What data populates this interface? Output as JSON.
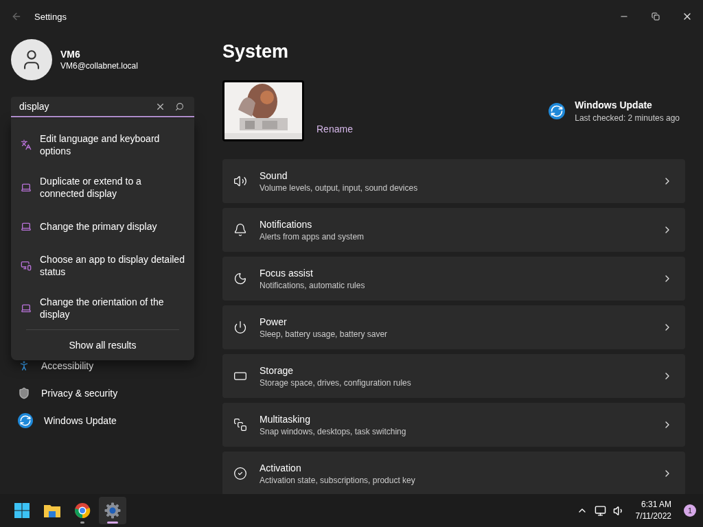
{
  "window": {
    "title": "Settings"
  },
  "profile": {
    "name": "VM6",
    "email": "VM6@collabnet.local"
  },
  "search": {
    "value": "display"
  },
  "search_results": {
    "items": [
      {
        "label": "Edit language and keyboard options"
      },
      {
        "label": "Duplicate or extend to a connected display"
      },
      {
        "label": "Change the primary display"
      },
      {
        "label": "Choose an app to display detailed status"
      },
      {
        "label": "Change the orientation of the display"
      }
    ],
    "show_all": "Show all results"
  },
  "sidebar": {
    "items": [
      {
        "label": "Accessibility"
      },
      {
        "label": "Privacy & security"
      },
      {
        "label": "Windows Update"
      }
    ]
  },
  "page": {
    "title": "System",
    "device": {
      "action": "Rename"
    },
    "update": {
      "title": "Windows Update",
      "status": "Last checked: 2 minutes ago"
    }
  },
  "cards": [
    {
      "title": "Sound",
      "subtitle": "Volume levels, output, input, sound devices"
    },
    {
      "title": "Notifications",
      "subtitle": "Alerts from apps and system"
    },
    {
      "title": "Focus assist",
      "subtitle": "Notifications, automatic rules"
    },
    {
      "title": "Power",
      "subtitle": "Sleep, battery usage, battery saver"
    },
    {
      "title": "Storage",
      "subtitle": "Storage space, drives, configuration rules"
    },
    {
      "title": "Multitasking",
      "subtitle": "Snap windows, desktops, task switching"
    },
    {
      "title": "Activation",
      "subtitle": "Activation state, subscriptions, product key"
    }
  ],
  "taskbar": {
    "apps": [
      {
        "selected": false,
        "running": false
      },
      {
        "selected": false,
        "running": false
      },
      {
        "selected": false,
        "running": true
      },
      {
        "selected": true,
        "running": true
      }
    ],
    "time": "6:31 AM",
    "date": "7/11/2022",
    "notifications": "1"
  }
}
